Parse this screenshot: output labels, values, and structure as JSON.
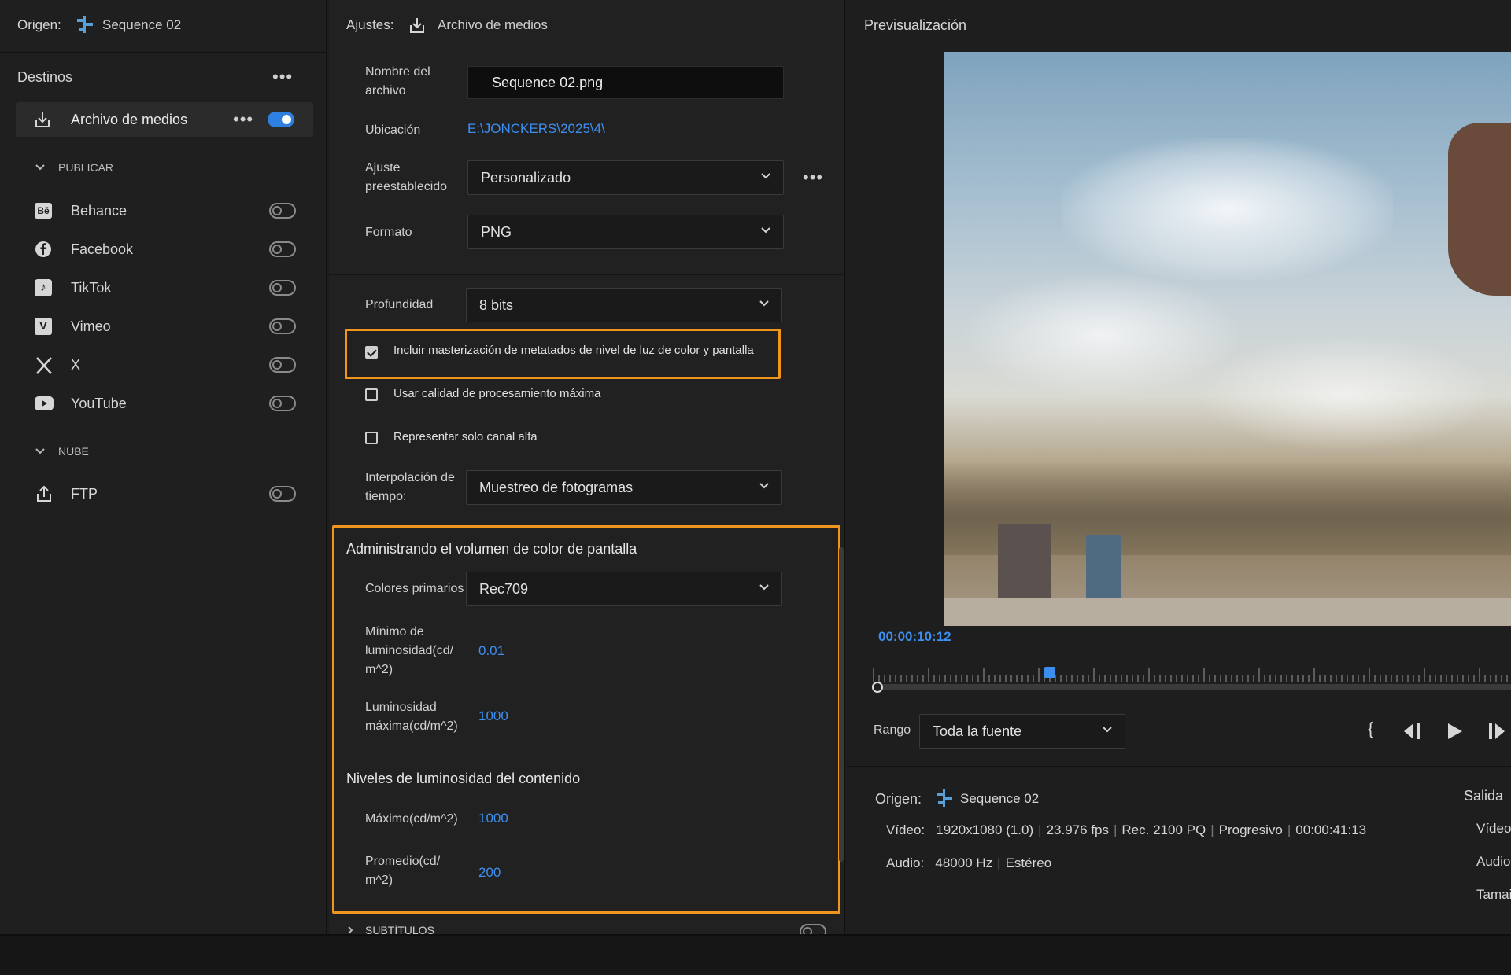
{
  "left": {
    "source_label": "Origen:",
    "source_value": "Sequence 02",
    "destinations_title": "Destinos",
    "media_file_label": "Archivo de medios",
    "publish_section": "PUBLICAR",
    "cloud_section": "NUBE",
    "items": [
      {
        "label": "Behance",
        "icon": "behance-icon"
      },
      {
        "label": "Facebook",
        "icon": "facebook-icon"
      },
      {
        "label": "TikTok",
        "icon": "tiktok-icon"
      },
      {
        "label": "Vimeo",
        "icon": "vimeo-icon"
      },
      {
        "label": "X",
        "icon": "x-icon"
      },
      {
        "label": "YouTube",
        "icon": "youtube-icon"
      }
    ],
    "ftp_label": "FTP"
  },
  "mid": {
    "settings_label": "Ajustes:",
    "settings_value": "Archivo de medios",
    "filename_label_1": "Nombre del",
    "filename_label_2": "archivo",
    "filename_value": "Sequence 02.png",
    "location_label": "Ubicación",
    "location_value": "E:\\JONCKERS\\2025\\4\\",
    "preset_label_1": "Ajuste",
    "preset_label_2": "preestablecido",
    "preset_value": "Personalizado",
    "format_label": "Formato",
    "format_value": "PNG",
    "depth_label": "Profundidad",
    "depth_value": "8 bits",
    "check_metadata": "Incluir masterización de metatados de nivel de luz de color y pantalla",
    "check_quality": "Usar calidad de procesamiento máxima",
    "check_alpha": "Representar solo canal alfa",
    "interp_label_1": "Interpolación de",
    "interp_label_2": "tiempo:",
    "interp_value": "Muestreo de fotogramas",
    "color_volume_title": "Administrando el volumen de color de pantalla",
    "primaries_label": "Colores primarios",
    "primaries_value": "Rec709",
    "min_lum_label_1": "Mínimo de",
    "min_lum_label_2": "luminosidad(cd/",
    "min_lum_label_3": "m^2)",
    "min_lum_value": "0.01",
    "max_lum_label_1": "Luminosidad",
    "max_lum_label_2": "máxima(cd/m^2)",
    "max_lum_value": "1000",
    "content_levels_title": "Niveles de luminosidad del contenido",
    "max_label": "Máximo(cd/m^2)",
    "max_value": "1000",
    "avg_label_1": "Promedio(cd/",
    "avg_label_2": "m^2)",
    "avg_value": "200",
    "subtitles_label": "SUBTÍTULOS"
  },
  "right": {
    "preview_title": "Previsualización",
    "timecode": "00:00:10:12",
    "range_label": "Rango",
    "range_value": "Toda la fuente",
    "source_label": "Origen:",
    "source_value": "Sequence 02",
    "output_label": "Salida",
    "video_label": "Vídeo:",
    "video_res": "1920x1080 (1.0)",
    "video_fps": "23.976 fps",
    "video_color": "Rec. 2100 PQ",
    "video_scan": "Progresivo",
    "video_dur": "00:00:41:13",
    "audio_label": "Audio:",
    "audio_hz": "48000 Hz",
    "audio_ch": "Estéreo",
    "out_video": "Vídeo",
    "out_audio": "Audio",
    "out_size": "Tamai",
    "playhead_fraction": 0.25
  },
  "colors": {
    "accent": "#2d7fe0",
    "highlight": "#f0961e",
    "link": "#3c8ff0"
  }
}
